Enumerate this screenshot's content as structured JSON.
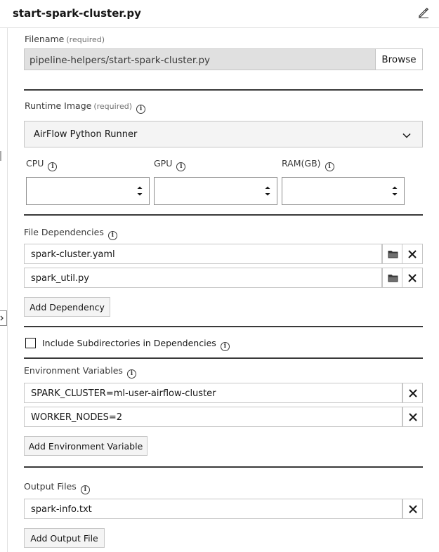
{
  "header": {
    "title": "start-spark-cluster.py"
  },
  "filename": {
    "label": "Filename",
    "required": "(required)",
    "value": "pipeline-helpers/start-spark-cluster.py",
    "browse_label": "Browse"
  },
  "runtime": {
    "label": "Runtime Image",
    "required": "(required)",
    "selected": "AirFlow Python Runner"
  },
  "resources": {
    "cpu_label": "CPU",
    "gpu_label": "GPU",
    "ram_label": "RAM(GB)"
  },
  "dependencies": {
    "label": "File Dependencies",
    "items": [
      "spark-cluster.yaml",
      "spark_util.py"
    ],
    "add_label": "Add Dependency",
    "include_subdirs_label": "Include Subdirectories in Dependencies",
    "include_subdirs_checked": false
  },
  "env": {
    "label": "Environment Variables",
    "items": [
      "SPARK_CLUSTER=ml-user-airflow-cluster",
      "WORKER_NODES=2"
    ],
    "add_label": "Add Environment Variable"
  },
  "outputs": {
    "label": "Output Files",
    "items": [
      "spark-info.txt"
    ],
    "add_label": "Add Output File"
  },
  "icons": {
    "edit": "pencil-icon",
    "info": "info-icon",
    "folder": "folder-icon",
    "remove": "close-icon",
    "dropdown": "chevron-down-icon",
    "spinner": "stepper-icon"
  }
}
